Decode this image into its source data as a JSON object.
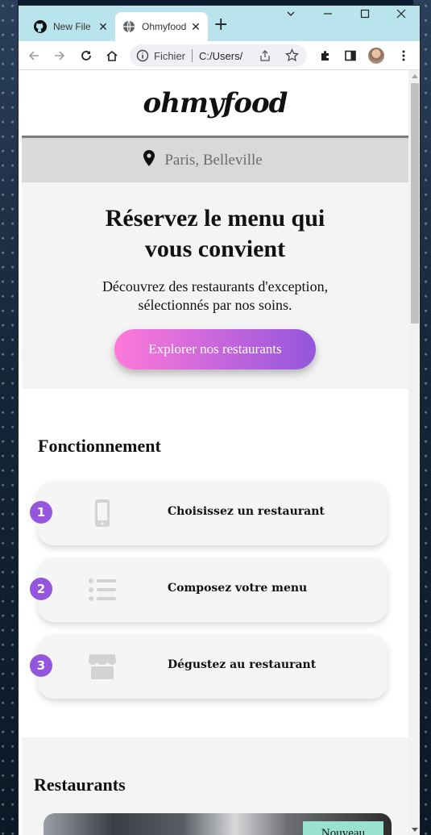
{
  "browser": {
    "tabs": [
      {
        "label": "New File",
        "favicon": "github-icon"
      },
      {
        "label": "Ohmyfood",
        "favicon": "globe-icon",
        "active": true
      }
    ],
    "address": {
      "scheme_label": "Fichier",
      "url": "C:/Users/"
    },
    "window_controls": {
      "menu": "⌄",
      "minimize": "—",
      "maximize": "☐",
      "close": "✕"
    }
  },
  "page": {
    "logo": "ohmyfood",
    "location": "Paris, Belleville",
    "hero": {
      "title": "Réservez le menu qui vous convient",
      "subtitle": "Découvrez des restaurants d'exception, sélectionnés par nos soins.",
      "cta": "Explorer nos restaurants"
    },
    "how_it_works": {
      "title": "Fonctionnement",
      "steps": [
        {
          "number": "1",
          "icon": "mobile-phone-icon",
          "label": "Choisissez un restaurant"
        },
        {
          "number": "2",
          "icon": "list-icon",
          "label": "Composez votre menu"
        },
        {
          "number": "3",
          "icon": "store-icon",
          "label": "Dégustez au restaurant"
        }
      ]
    },
    "restaurants": {
      "title": "Restaurants",
      "first_card_badge": "Nouveau"
    }
  },
  "colors": {
    "accent_purple": "#9356dc",
    "accent_pink": "#ff79da",
    "badge_teal": "#99e2d0",
    "tab_strip": "#b9e4ee"
  }
}
